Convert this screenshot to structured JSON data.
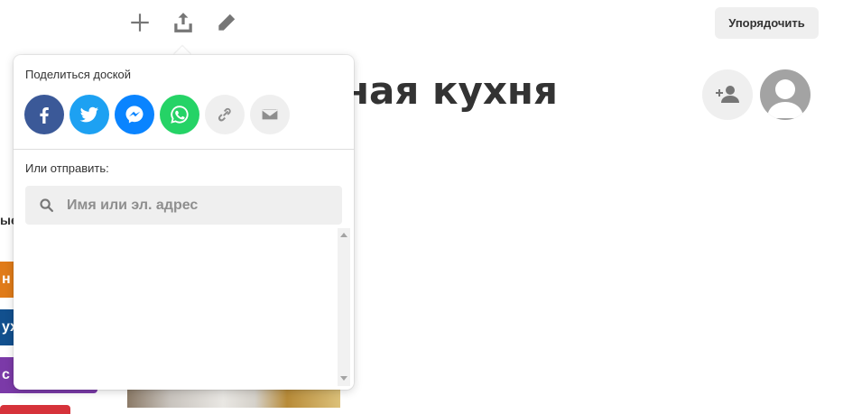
{
  "toolbar": {
    "sort_label": "Упорядочить",
    "icons": [
      "plus-icon",
      "upload-share-icon",
      "pencil-icon"
    ]
  },
  "board": {
    "title_visible": "ная кухня"
  },
  "left_edge": {
    "text": "ые",
    "chips": [
      "н",
      "ух",
      "с"
    ]
  },
  "share_popover": {
    "title": "Поделиться доской",
    "send_label": "Или отправить:",
    "search_placeholder": "Имя или эл. адрес",
    "search_value": "",
    "social": [
      "facebook-icon",
      "twitter-icon",
      "messenger-icon",
      "whatsapp-icon",
      "link-icon",
      "email-icon"
    ]
  },
  "colors": {
    "facebook": "#3b5998",
    "twitter": "#1da1f2",
    "messenger": "#0a84ff",
    "whatsapp": "#25d366",
    "neutral_button": "#efefef"
  }
}
